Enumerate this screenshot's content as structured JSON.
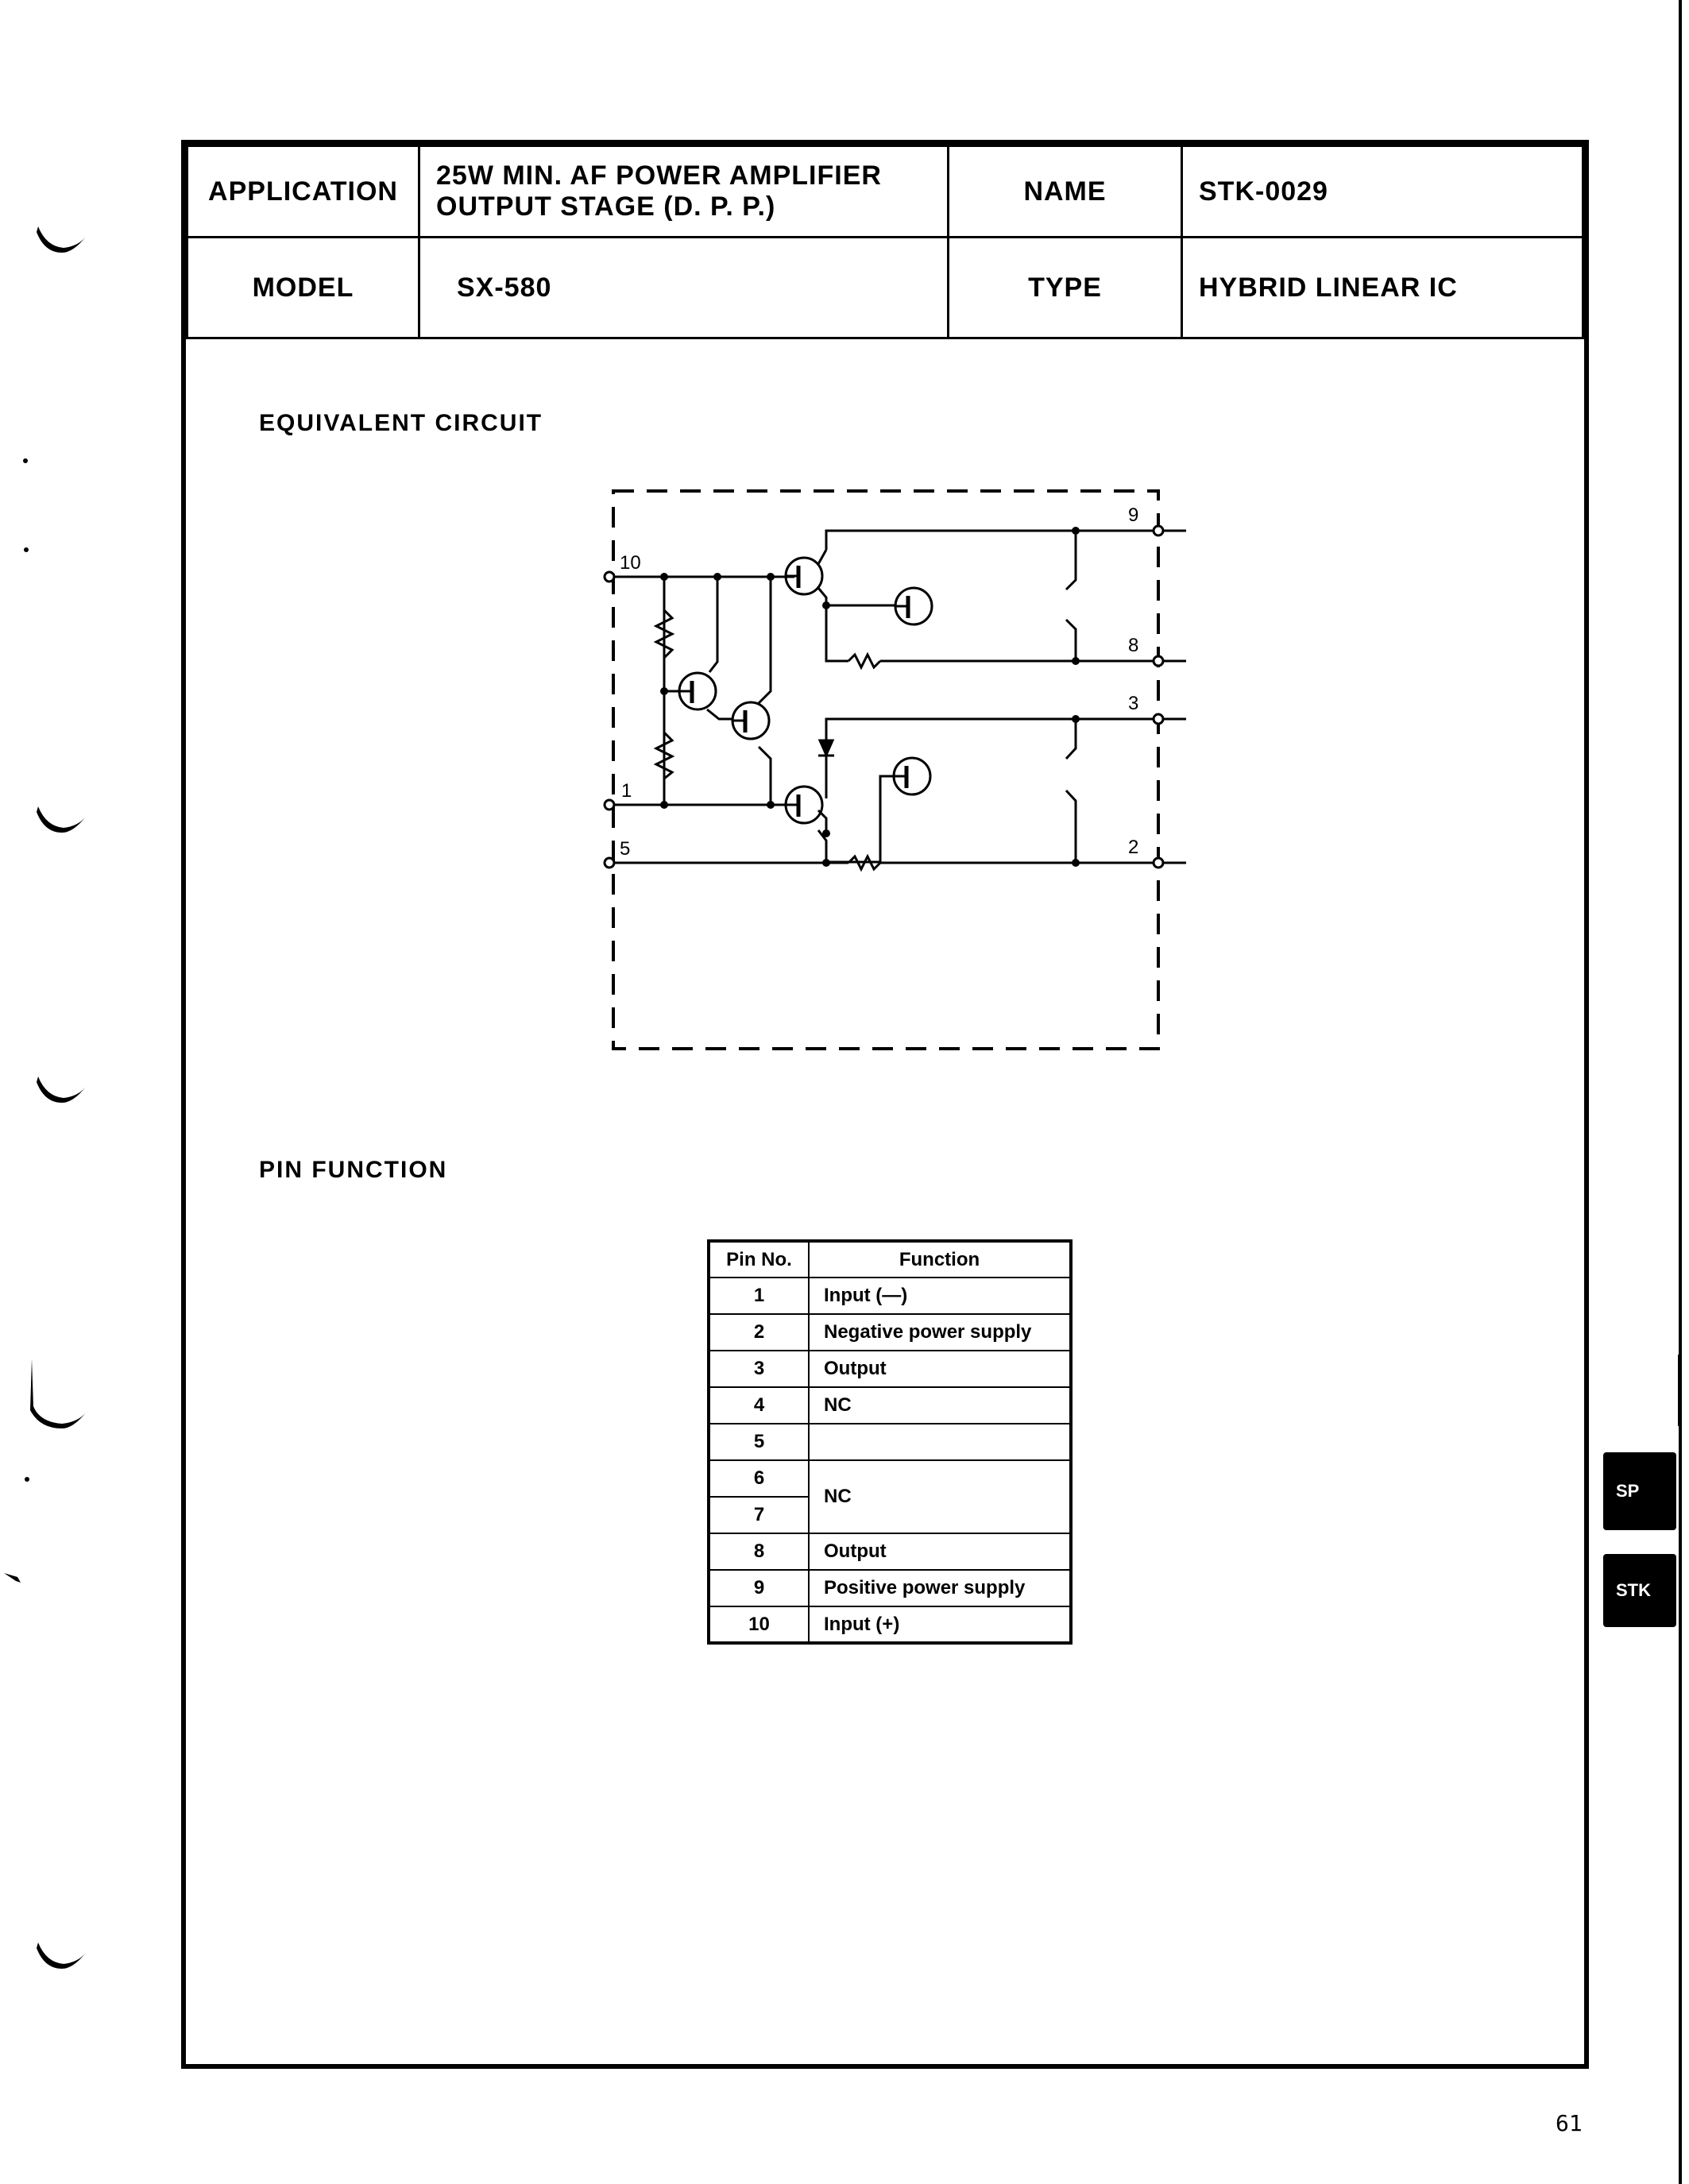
{
  "header": {
    "application_label": "APPLICATION",
    "application_line1": "25W MIN. AF POWER AMPLIFIER",
    "application_line2": "OUTPUT STAGE (D. P. P.)",
    "name_label": "NAME",
    "name_value": "STK-0029",
    "model_label": "MODEL",
    "model_value": "SX-580",
    "type_label": "TYPE",
    "type_value": "HYBRID LINEAR IC"
  },
  "equivalent_circuit": {
    "title": "EQUIVALENT CIRCUIT",
    "pin_labels": {
      "p9": "9",
      "p10": "10",
      "p8": "8",
      "p3": "3",
      "p1": "1",
      "p5": "5",
      "p2": "2"
    }
  },
  "pin_function": {
    "title": "PIN FUNCTION",
    "columns": [
      "Pin No.",
      "Function"
    ],
    "rows": [
      {
        "pin": "1",
        "function": "Input (—)"
      },
      {
        "pin": "2",
        "function": "Negative power supply"
      },
      {
        "pin": "3",
        "function": "Output"
      },
      {
        "pin": "4",
        "function": "NC"
      },
      {
        "pin": "5",
        "function": ""
      },
      {
        "pin": "6",
        "function": "NC"
      },
      {
        "pin": "7",
        "function": ""
      },
      {
        "pin": "8",
        "function": "Output"
      },
      {
        "pin": "9",
        "function": "Positive power supply"
      },
      {
        "pin": "10",
        "function": "Input (+)"
      }
    ]
  },
  "side_tabs": [
    "SP",
    "STK"
  ],
  "page_number": "61"
}
